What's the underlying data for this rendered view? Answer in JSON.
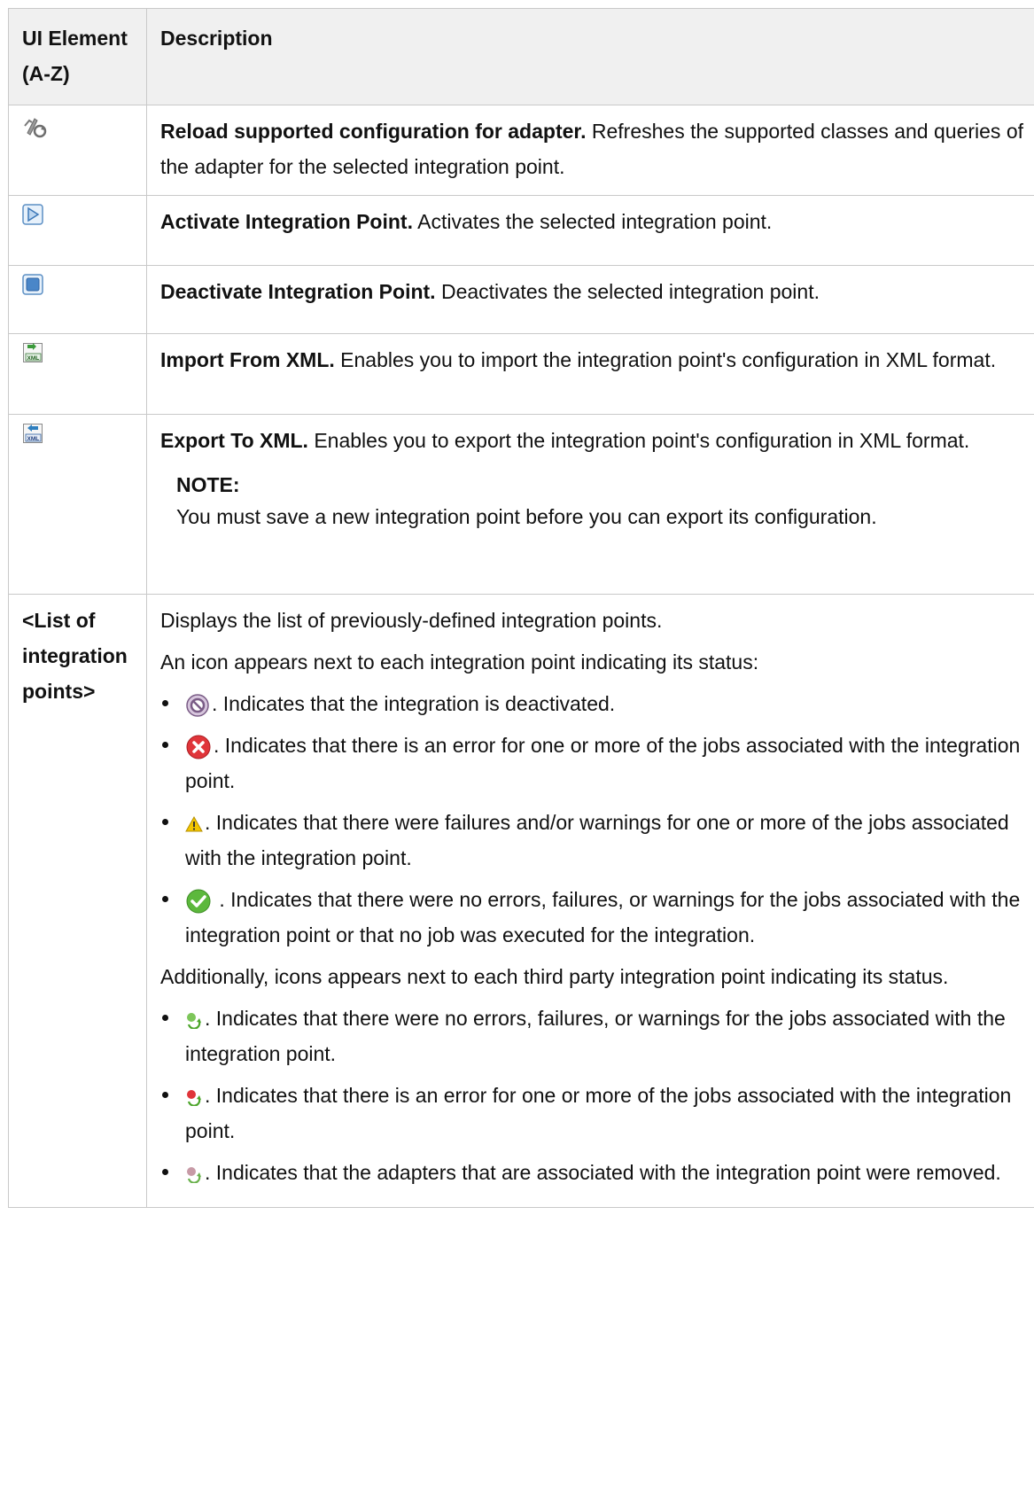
{
  "header": {
    "col1": "UI Element (A-Z)",
    "col2": "Description"
  },
  "rows": [
    {
      "icon": "reload-config-icon",
      "title": "Reload supported configuration for adapter.",
      "text": " Refreshes the supported classes and queries of the adapter for the selected integration point."
    },
    {
      "icon": "activate-play-icon",
      "title": "Activate Integration Point.",
      "text": " Activates the selected integration point."
    },
    {
      "icon": "deactivate-stop-icon",
      "title": "Deactivate Integration Point.",
      "text": " Deactivates the selected integration point."
    },
    {
      "icon": "import-xml-icon",
      "title": "Import From XML.",
      "text": " Enables you to import the integration point's configuration in XML format."
    },
    {
      "icon": "export-xml-icon",
      "title": "Export To XML.",
      "text": " Enables you to export the integration point's configuration in XML format.",
      "note_title": "NOTE:",
      "note_text": "You must save a new integration point before you can export its configuration."
    }
  ],
  "list_row": {
    "label": "<List of integration points>",
    "intro": "Displays the list of previously-defined integration points.",
    "icons_intro": "An icon appears next to each integration point indicating its status:",
    "statuses": [
      {
        "icon": "deactivated-status-icon",
        "text": ". Indicates that the integration is deactivated."
      },
      {
        "icon": "error-status-icon",
        "text": ". Indicates that there is an error for one or more of the jobs associated with the integration point."
      },
      {
        "icon": "warning-status-icon",
        "text": ". Indicates that there were failures and/or warnings for one or more of the jobs associated with the integration point."
      },
      {
        "icon": "success-status-icon",
        "text": " . Indicates that there were no errors, failures, or warnings for the jobs associated with the integration point or that no job was executed for the integration."
      }
    ],
    "third_party_intro": "Additionally, icons appears next to each third party integration point indicating its status.",
    "third_party_statuses": [
      {
        "icon": "third-party-success-icon",
        "text": ". Indicates that there were no errors, failures, or warnings for the jobs associated with the integration point."
      },
      {
        "icon": "third-party-error-icon",
        "text": ". Indicates that there is an error for one or more of the jobs associated with the integration point."
      },
      {
        "icon": "third-party-removed-icon",
        "text": ". Indicates that the adapters that are associated with the integration point were removed."
      }
    ]
  },
  "colors": {
    "border": "#c9c9c9",
    "header_bg": "#f0f0f0",
    "error_red": "#e0353a",
    "success_green": "#5cb83c",
    "warning_yellow": "#f2c500",
    "deactivated_purple": "#7a5c86"
  }
}
